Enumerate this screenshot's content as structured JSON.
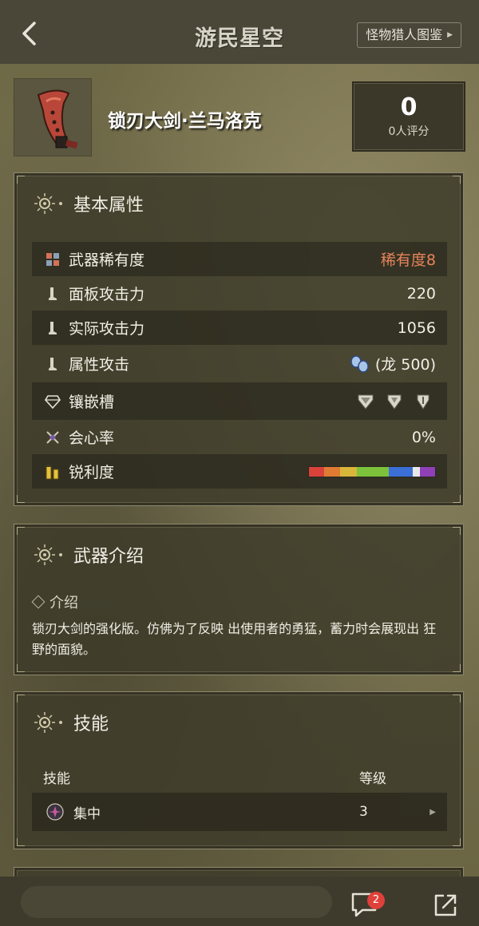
{
  "topbar": {
    "brand": "游民星空",
    "wiki_link": "怪物猎人图鉴"
  },
  "weapon": {
    "name": "锁刃大剑·兰马洛克",
    "rating_value": "0",
    "rating_label": "0人评分"
  },
  "basic_attrs": {
    "title": "基本属性",
    "rows": [
      {
        "label": "武器稀有度",
        "value": "稀有度8",
        "icon": "rarity-icon"
      },
      {
        "label": "面板攻击力",
        "value": "220",
        "icon": "attack-icon"
      },
      {
        "label": "实际攻击力",
        "value": "1056",
        "icon": "attack-icon"
      },
      {
        "label": "属性攻击",
        "value": "(龙 500)",
        "icon": "element-icon"
      },
      {
        "label": "镶嵌槽",
        "value": "",
        "icon": "slot-icon"
      },
      {
        "label": "会心率",
        "value": "0%",
        "icon": "affinity-icon"
      },
      {
        "label": "锐利度",
        "value": "",
        "icon": "sharpness-icon"
      }
    ],
    "sharpness": [
      {
        "color": "#d9423b",
        "fraction": 0.12
      },
      {
        "color": "#e07b33",
        "fraction": 0.13
      },
      {
        "color": "#d8b63a",
        "fraction": 0.13
      },
      {
        "color": "#7cc23a",
        "fraction": 0.25
      },
      {
        "color": "#3b6fd6",
        "fraction": 0.19
      },
      {
        "color": "#e8e8e8",
        "fraction": 0.06
      },
      {
        "color": "#8f3fb8",
        "fraction": 0.12
      }
    ]
  },
  "intro": {
    "title": "武器介绍",
    "sub_title": "介绍",
    "text": "锁刃大剑的强化版。仿佛为了反映 出使用者的勇猛，蓄力时会展现出 狂野的面貌。"
  },
  "skills": {
    "title": "技能",
    "col_skill": "技能",
    "col_level": "等级",
    "items": [
      {
        "name": "集中",
        "level": "3"
      }
    ]
  },
  "bottombar": {
    "comment_count": "2"
  },
  "colors": {
    "rarity": "#e6845a",
    "badge": "#e0403a"
  }
}
